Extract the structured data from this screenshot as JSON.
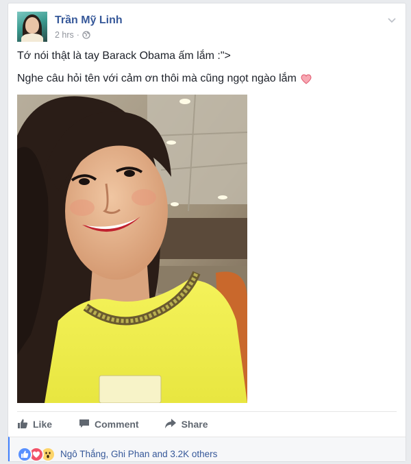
{
  "post": {
    "author": "Trần Mỹ Linh",
    "timestamp": "2 hrs",
    "separator": "·",
    "privacy_icon": "globe-icon",
    "menu_icon": "chevron-down-icon",
    "text_line1": "Tớ nói thật là tay Barack Obama ấm lắm :\">",
    "text_line2": "Nghe câu hỏi tên với cảm ơn thôi mà cũng ngọt ngào lắm",
    "emoji_icon": "heart-icon"
  },
  "actions": {
    "like": "Like",
    "comment": "Comment",
    "share": "Share"
  },
  "reactions": {
    "icons": [
      "like-reaction-icon",
      "love-reaction-icon",
      "wow-reaction-icon"
    ],
    "summary": "Ngô Thắng, Ghi Phan and 3.2K others"
  },
  "colors": {
    "link_blue": "#365899",
    "action_gray": "#606770",
    "accent_blue": "#4080ff",
    "heart_pink": "#f25268"
  }
}
